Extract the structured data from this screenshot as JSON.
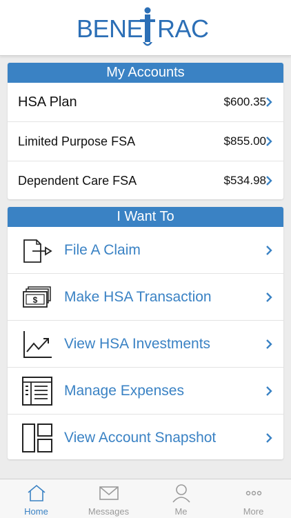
{
  "brand": {
    "logo_text": "BENETRAC",
    "logo_color": "#2c6fb6"
  },
  "accounts": {
    "title": "My Accounts",
    "items": [
      {
        "name": "HSA Plan",
        "amount": "$600.35"
      },
      {
        "name": "Limited Purpose FSA",
        "amount": "$855.00"
      },
      {
        "name": "Dependent Care FSA",
        "amount": "$534.98"
      }
    ]
  },
  "actions": {
    "title": "I Want To",
    "items": [
      {
        "label": "File A Claim",
        "icon": "file-claim-icon"
      },
      {
        "label": "Make HSA Transaction",
        "icon": "money-icon"
      },
      {
        "label": "View HSA Investments",
        "icon": "chart-icon"
      },
      {
        "label": "Manage Expenses",
        "icon": "expenses-icon"
      },
      {
        "label": "View Account Snapshot",
        "icon": "snapshot-icon"
      }
    ]
  },
  "tabs": [
    {
      "label": "Home",
      "icon": "home-icon",
      "active": true
    },
    {
      "label": "Messages",
      "icon": "envelope-icon",
      "active": false
    },
    {
      "label": "Me",
      "icon": "person-icon",
      "active": false
    },
    {
      "label": "More",
      "icon": "more-icon",
      "active": false
    }
  ],
  "colors": {
    "accent": "#3a82c4",
    "inactive": "#9a9a9a"
  }
}
